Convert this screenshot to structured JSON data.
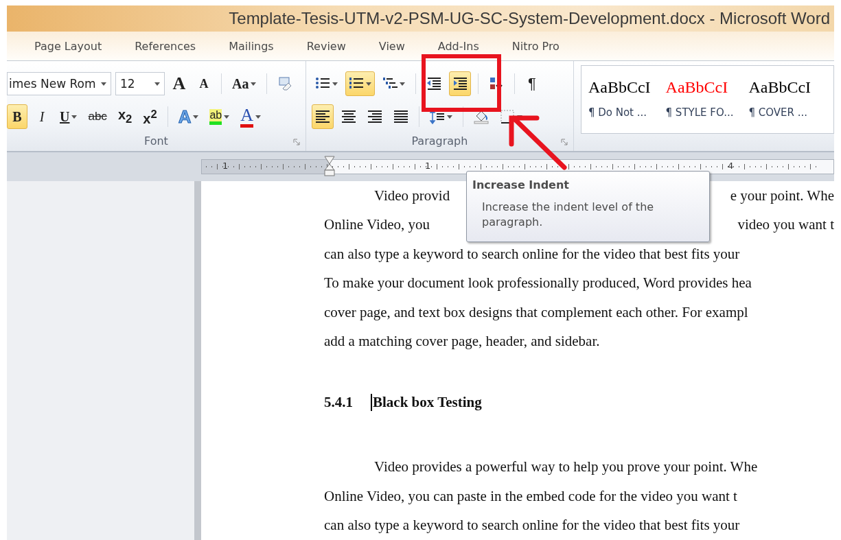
{
  "window": {
    "title": "Template-Tesis-UTM-v2-PSM-UG-SC-System-Development.docx  -  Microsoft Word"
  },
  "ribbon_tabs": [
    {
      "label": "Page Layout"
    },
    {
      "label": "References"
    },
    {
      "label": "Mailings"
    },
    {
      "label": "Review"
    },
    {
      "label": "View"
    },
    {
      "label": "Add-Ins"
    },
    {
      "label": "Nitro Pro"
    }
  ],
  "font_group": {
    "label": "Font",
    "font_name": "imes New Rom",
    "font_size": "12",
    "row_1": [
      {
        "kind": "grow",
        "label": "A",
        "selected": false
      },
      {
        "kind": "shrink",
        "label": "A",
        "selected": false
      },
      {
        "kind": "case",
        "label": "Aa",
        "dropdown": true,
        "selected": false
      },
      {
        "kind": "clear",
        "selected": false
      }
    ],
    "row_2": [
      {
        "kind": "bold",
        "label": "B",
        "selected": true
      },
      {
        "kind": "italic",
        "label": "I",
        "selected": false
      },
      {
        "kind": "underline",
        "label": "U",
        "dropdown": true,
        "selected": false
      },
      {
        "kind": "strike",
        "label": "abc",
        "selected": false
      },
      {
        "kind": "subscript",
        "label": "x$_{2}$",
        "selected": false
      },
      {
        "kind": "superscript",
        "label": "x$^{2}$",
        "selected": false
      },
      {
        "kind": "effects",
        "label": "A",
        "dropdown": true,
        "selected": false
      },
      {
        "kind": "highlight",
        "label": "ab",
        "dropdown": true,
        "selected": false
      },
      {
        "kind": "fontcolor",
        "label": "A",
        "dropdown": true,
        "selected": false
      }
    ]
  },
  "paragraph_group": {
    "label": "Paragraph",
    "row_1": [
      {
        "kind": "bullets",
        "dropdown": true,
        "selected": false
      },
      {
        "kind": "numbering",
        "dropdown": true,
        "selected": true
      },
      {
        "kind": "multilevel",
        "dropdown": true,
        "selected": false
      },
      {
        "kind": "outdent",
        "selected": false
      },
      {
        "kind": "indent",
        "selected": true
      },
      {
        "kind": "sort",
        "selected": false
      },
      {
        "kind": "pilcrow",
        "label": "¶",
        "selected": false
      }
    ],
    "row_2": [
      {
        "kind": "left",
        "selected": true
      },
      {
        "kind": "center",
        "selected": false
      },
      {
        "kind": "right",
        "selected": false
      },
      {
        "kind": "justify",
        "selected": false
      },
      {
        "kind": "spacing",
        "dropdown": true,
        "selected": false
      },
      {
        "kind": "shading",
        "selected": false
      },
      {
        "kind": "borders",
        "dropdown": true,
        "selected": false
      }
    ]
  },
  "styles": [
    {
      "sample": "AaBbCcI",
      "name": "¶ Do Not ...",
      "color": "#000000"
    },
    {
      "sample": "AaBbCcI",
      "name": "¶ STYLE FO...",
      "color": "#ff0000"
    },
    {
      "sample": "AaBbCcI",
      "name": "¶ COVER ...",
      "color": "#000000"
    }
  ],
  "ruler": {
    "labels": [
      "1",
      "1",
      "4"
    ]
  },
  "tooltip": {
    "title": "Increase Indent",
    "text": "Increase the indent level of the paragraph."
  },
  "document": [
    {
      "kind": "indented_split",
      "left": "Video provid",
      "right": "e your point. Whe"
    },
    {
      "kind": "split",
      "left": "Online Video, you",
      "right": "video you want t"
    },
    {
      "kind": "line",
      "text": "can also type a keyword to search online for the video that best fits your"
    },
    {
      "kind": "line",
      "text": "To make your document look professionally produced, Word provides hea"
    },
    {
      "kind": "line",
      "text": "cover page, and text box designs that complement each other. For exampl"
    },
    {
      "kind": "line",
      "text": "add a matching cover page, header, and sidebar."
    },
    {
      "kind": "heading",
      "number": "5.4.1",
      "text": "Black box Testing"
    },
    {
      "kind": "indented_line",
      "text": "Video provides a powerful way to help you prove your point. Whe"
    },
    {
      "kind": "line",
      "text": "Online Video, you can paste in the embed code for the video you want t"
    },
    {
      "kind": "line",
      "text": "can also type a keyword to search online for the video that best fits your"
    }
  ]
}
